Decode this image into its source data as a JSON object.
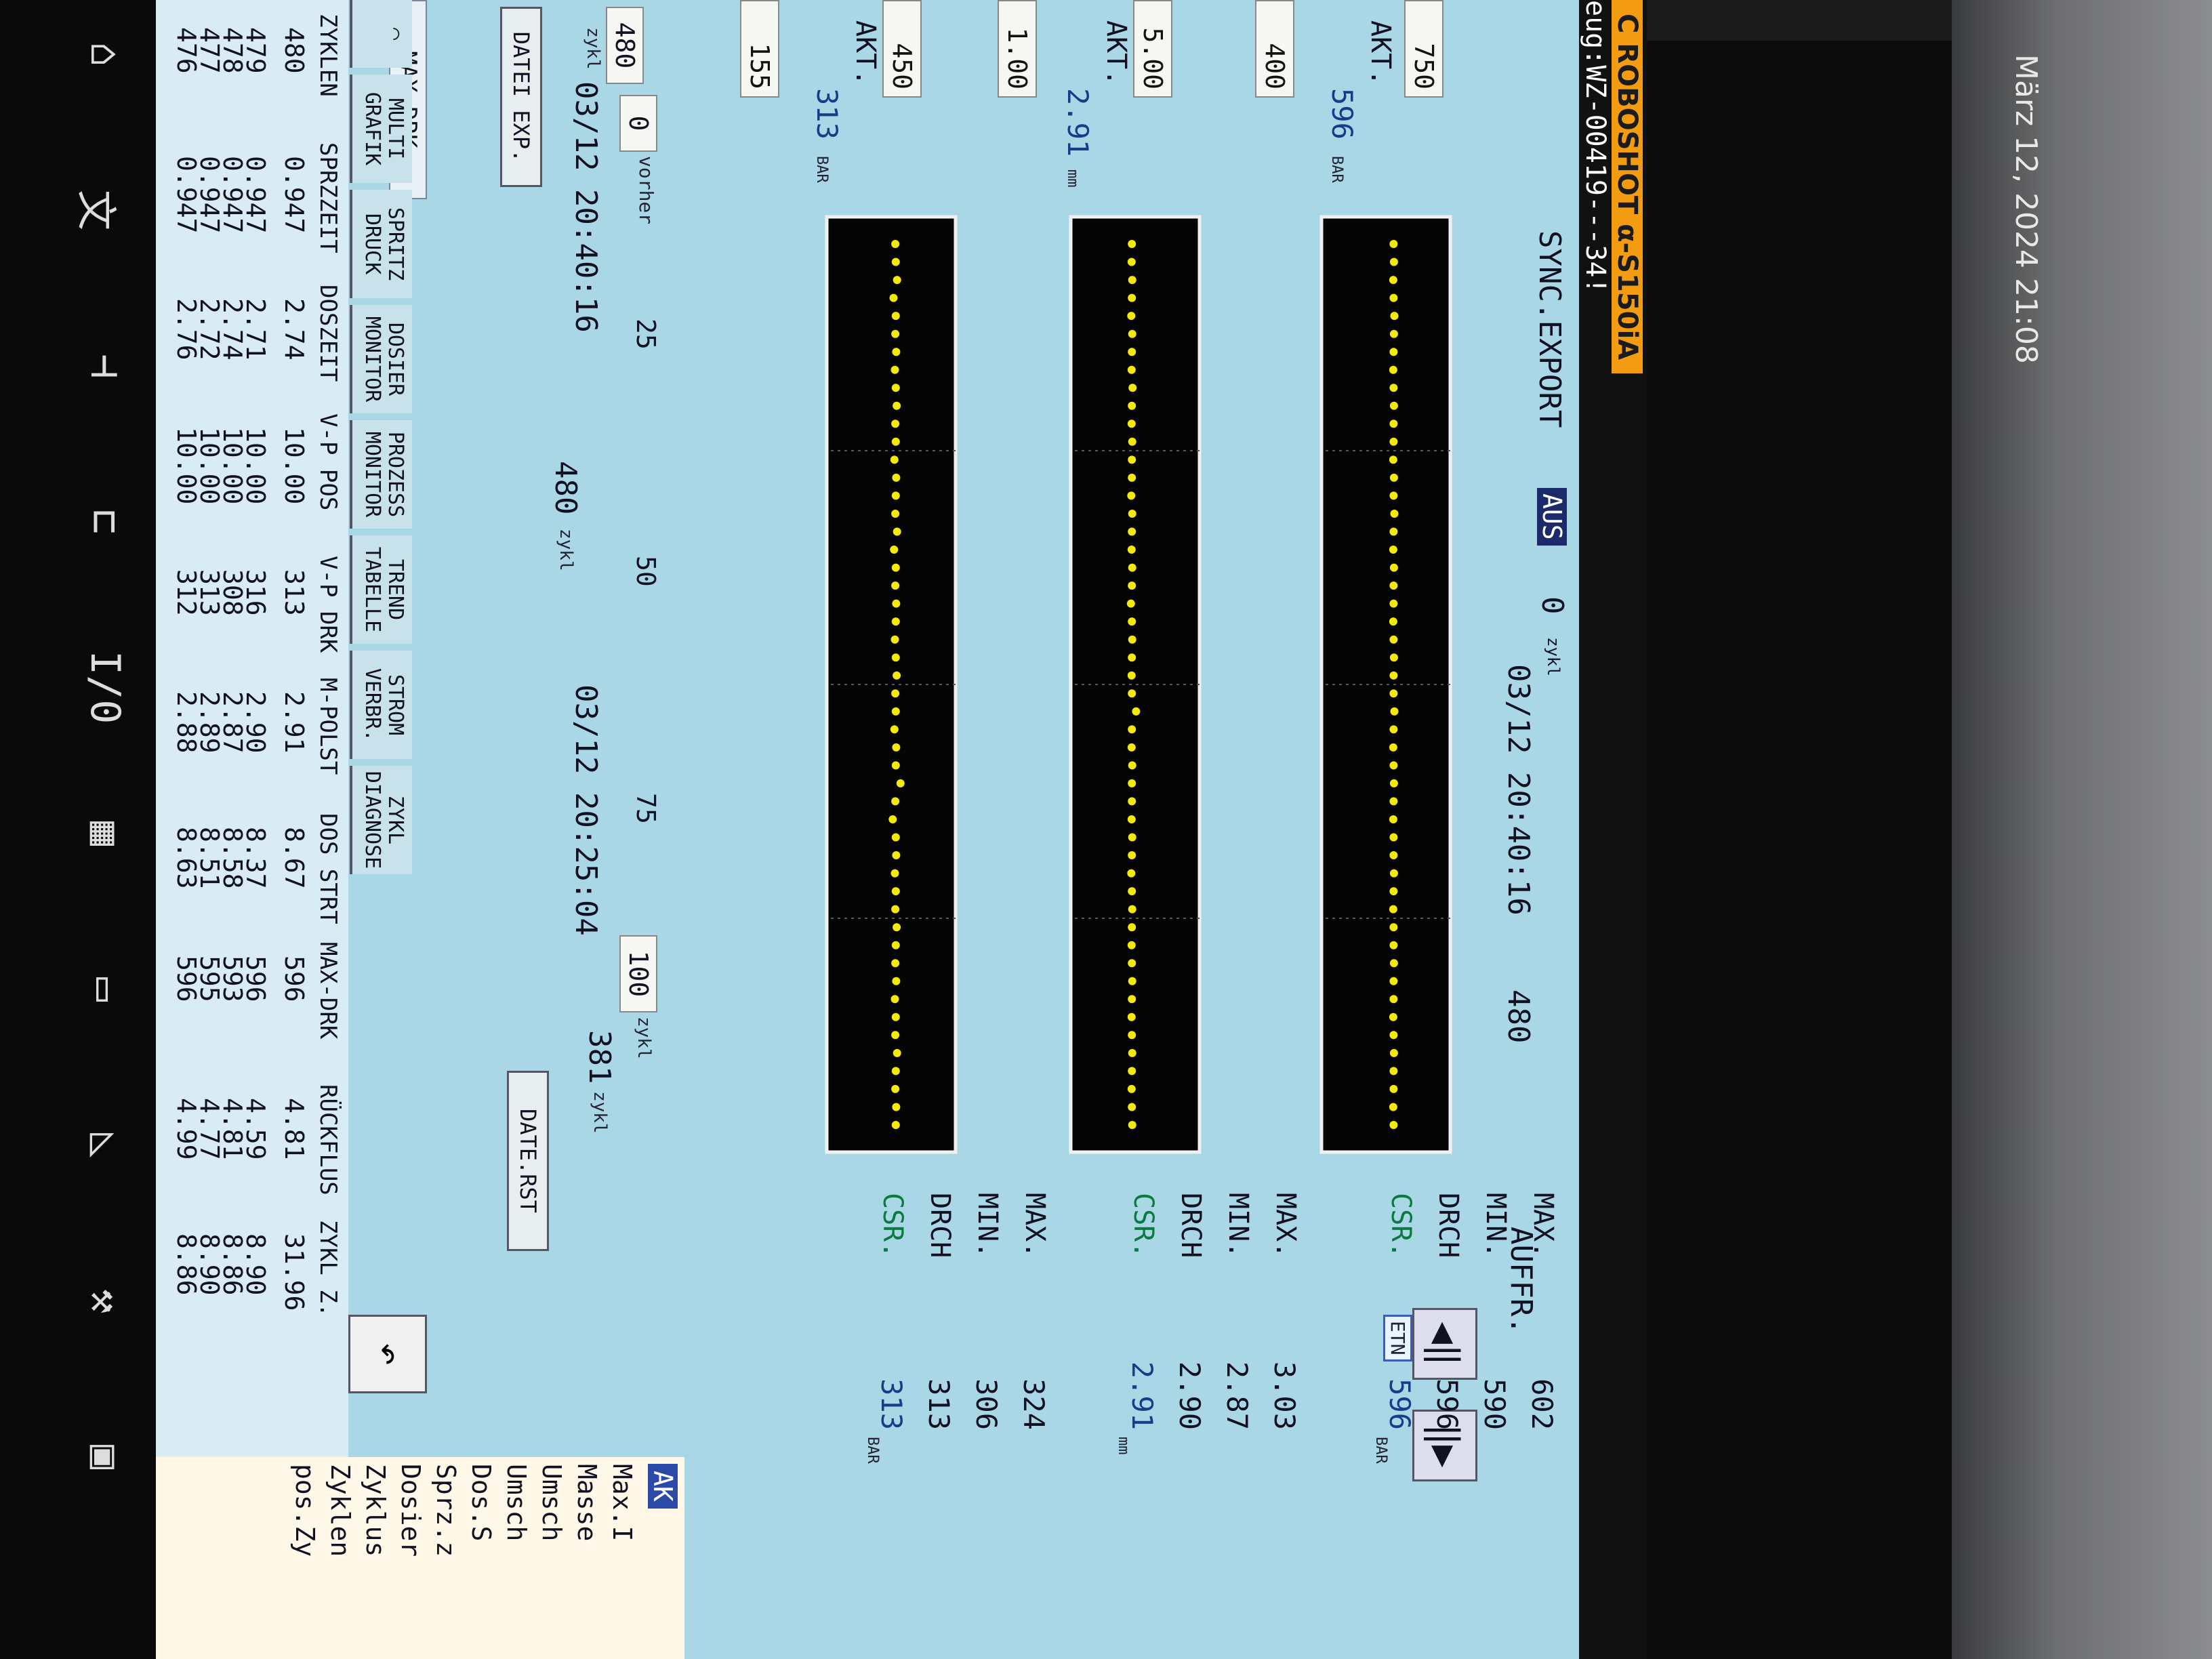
{
  "photo": {
    "timestamp": "März 12, 2024 21:08"
  },
  "header": {
    "brand": "C ROBOSHOT α-S150iA",
    "tool": "eug:WZ-00419---34!"
  },
  "top": {
    "sync_label": "SYNC.EXPORT",
    "sync_state": "AUS",
    "count": "0",
    "count_unit": "zykl",
    "date": "03/12 20:40:16",
    "cycles": "480",
    "auffr": "AUFFR.",
    "etn": "ETN"
  },
  "rows": [
    {
      "label": "MAX DRK",
      "upper": "750",
      "lower": "400",
      "akt_label": "AKT.",
      "akt_value": "596",
      "unit": "BAR",
      "stats": {
        "max": "602",
        "min": "590",
        "drch": "596",
        "csr": "596",
        "unit": "BAR"
      }
    },
    {
      "label": "M-POLST",
      "upper": "5.00",
      "lower": "1.00",
      "akt_label": "AKT.",
      "akt_value": "2.91",
      "unit": "mm",
      "stats": {
        "max": "3.03",
        "min": "2.87",
        "drch": "2.90",
        "csr": "2.91",
        "unit": "mm"
      }
    },
    {
      "label": "V-P DRK",
      "upper": "450",
      "lower": "155",
      "akt_label": "AKT.",
      "akt_value": "313",
      "unit": "BAR",
      "stats": {
        "max": "324",
        "min": "306",
        "drch": "313",
        "csr": "313",
        "unit": "BAR"
      }
    }
  ],
  "stat_labels": {
    "max": "MAX.",
    "min": "MIN.",
    "drch": "DRCH",
    "csr": "CSR."
  },
  "axis": {
    "left_value": "480",
    "left_unit": "zykl",
    "vorher_value": "0",
    "vorher_label": "vorher",
    "ticks": [
      "25",
      "50",
      "75"
    ],
    "range_value": "100",
    "range_unit": "zykl",
    "from_date": "03/12 20:40:16",
    "mid_value": "480",
    "mid_unit": "zykl",
    "to_date": "03/12 20:25:04",
    "right_value": "381",
    "right_unit": "zykl"
  },
  "buttons": {
    "datei_exp": "DATEI EXP.",
    "date_rst": "DATE.RST"
  },
  "tabs": [
    {
      "line1": "MULTI",
      "line2": "GRAFIK"
    },
    {
      "line1": "SPRITZ",
      "line2": "DRUCK"
    },
    {
      "line1": "DOSIER",
      "line2": "MONITOR"
    },
    {
      "line1": "PROZESS",
      "line2": "MONITOR"
    },
    {
      "line1": "TREND",
      "line2": "TABELLE"
    },
    {
      "line1": "STROM",
      "line2": "VERBR."
    },
    {
      "line1": "ZYKL",
      "line2": "DIAGNOSE"
    }
  ],
  "table": {
    "headers": [
      "ZYKLEN",
      "SPRZZEIT",
      "DOSZEIT",
      "V-P POS",
      "V-P DRK",
      "M-POLST",
      "DOS STRT",
      "MAX-DRK",
      "RÜCKFLUS",
      "ZYKL Z."
    ],
    "current": [
      "480",
      "0.947",
      "2.74",
      "10.00",
      "313",
      "2.91",
      "8.67",
      "596",
      "4.81",
      "31.96"
    ],
    "history": [
      [
        "479",
        "0.947",
        "2.71",
        "10.00",
        "316",
        "2.90",
        "8.37",
        "596",
        "4.59",
        "8.90"
      ],
      [
        "478",
        "0.947",
        "2.74",
        "10.00",
        "308",
        "2.87",
        "8.58",
        "593",
        "4.81",
        "8.86"
      ],
      [
        "477",
        "0.947",
        "2.72",
        "10.00",
        "313",
        "2.89",
        "8.51",
        "595",
        "4.77",
        "8.90"
      ],
      [
        "476",
        "0.947",
        "2.76",
        "10.00",
        "312",
        "2.88",
        "8.63",
        "596",
        "4.99",
        "8.86"
      ]
    ]
  },
  "sidebar": {
    "ak": "AK",
    "lines": [
      "Max.I",
      "Masse",
      "Umsch",
      "Umsch",
      "Dos.S",
      "Sprz.z",
      "Dosier",
      "Zyklus",
      "Zyklen",
      "pos.Zy"
    ]
  },
  "bottom_icons": [
    "home-icon",
    "translate-icon",
    "injection-icon",
    "mold-icon",
    "io-icon",
    "calendar-icon",
    "monitor-icon",
    "ejector-icon",
    "wrench-icon",
    "save-icon"
  ],
  "chart_data": [
    {
      "type": "scatter",
      "series": [
        {
          "name": "MAX DRK",
          "values": [
            596,
            597,
            595,
            596,
            598,
            597,
            596,
            595,
            596,
            597,
            596,
            596,
            595,
            597,
            596,
            598,
            596,
            595,
            597,
            596,
            596,
            595,
            596,
            597,
            596,
            596,
            598,
            596,
            595,
            596,
            597,
            596,
            595,
            596,
            596,
            597,
            596,
            595,
            596,
            596,
            597,
            596,
            596,
            595,
            596,
            597,
            596,
            596,
            595,
            596
          ]
        }
      ],
      "ylim": [
        400,
        750
      ]
    },
    {
      "type": "scatter",
      "series": [
        {
          "name": "M-POLST",
          "values": [
            2.9,
            2.89,
            2.91,
            2.9,
            2.88,
            2.91,
            2.9,
            2.89,
            2.92,
            2.9,
            2.89,
            2.91,
            2.9,
            2.9,
            2.88,
            2.91,
            2.9,
            2.89,
            2.91,
            2.9,
            2.87,
            2.9,
            2.91,
            2.9,
            2.89,
            2.9,
            3.03,
            2.9,
            2.89,
            2.91,
            2.9,
            2.9,
            2.89,
            2.91,
            2.9,
            2.88,
            2.9,
            2.91,
            2.9,
            2.89,
            2.9,
            2.91,
            2.9,
            2.89,
            2.9,
            2.91,
            2.9,
            2.89,
            2.9,
            2.91
          ]
        }
      ],
      "ylim": [
        1.0,
        5.0
      ]
    },
    {
      "type": "scatter",
      "series": [
        {
          "name": "V-P DRK",
          "values": [
            312,
            313,
            316,
            308,
            313,
            312,
            314,
            311,
            313,
            315,
            312,
            313,
            310,
            314,
            313,
            312,
            316,
            309,
            313,
            312,
            314,
            313,
            311,
            313,
            315,
            312,
            313,
            310,
            314,
            313,
            324,
            312,
            306,
            313,
            314,
            311,
            313,
            312,
            315,
            313,
            312,
            314,
            311,
            313,
            312,
            316,
            313,
            312,
            314,
            313
          ]
        }
      ],
      "ylim": [
        155,
        450
      ]
    }
  ]
}
